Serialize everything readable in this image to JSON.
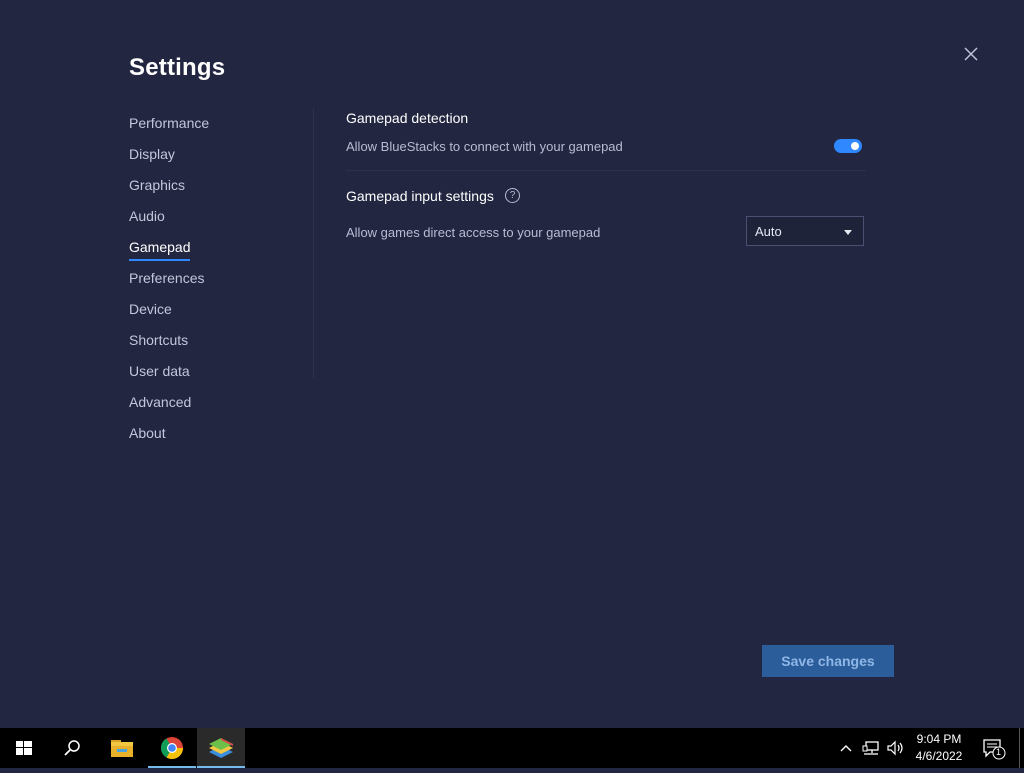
{
  "window": {
    "title": "Settings"
  },
  "nav": {
    "items": [
      {
        "label": "Performance"
      },
      {
        "label": "Display"
      },
      {
        "label": "Graphics"
      },
      {
        "label": "Audio"
      },
      {
        "label": "Gamepad"
      },
      {
        "label": "Preferences"
      },
      {
        "label": "Device"
      },
      {
        "label": "Shortcuts"
      },
      {
        "label": "User data"
      },
      {
        "label": "Advanced"
      },
      {
        "label": "About"
      }
    ],
    "active": "Gamepad"
  },
  "gamepad_detection": {
    "title": "Gamepad detection",
    "description": "Allow BlueStacks to connect with your gamepad",
    "enabled": true
  },
  "gamepad_input": {
    "title": "Gamepad input settings",
    "help_glyph": "?",
    "description": "Allow games direct access to your gamepad",
    "selected": "Auto"
  },
  "footer": {
    "save_label": "Save changes"
  },
  "taskbar": {
    "apps": [
      "windows-start",
      "search",
      "file-explorer",
      "chrome",
      "bluestacks"
    ],
    "time": "9:04 PM",
    "date": "4/6/2022",
    "notification_count": "1"
  },
  "colors": {
    "accent": "#2f88ff",
    "background": "#222640",
    "save_button": "#2a5d9a"
  }
}
